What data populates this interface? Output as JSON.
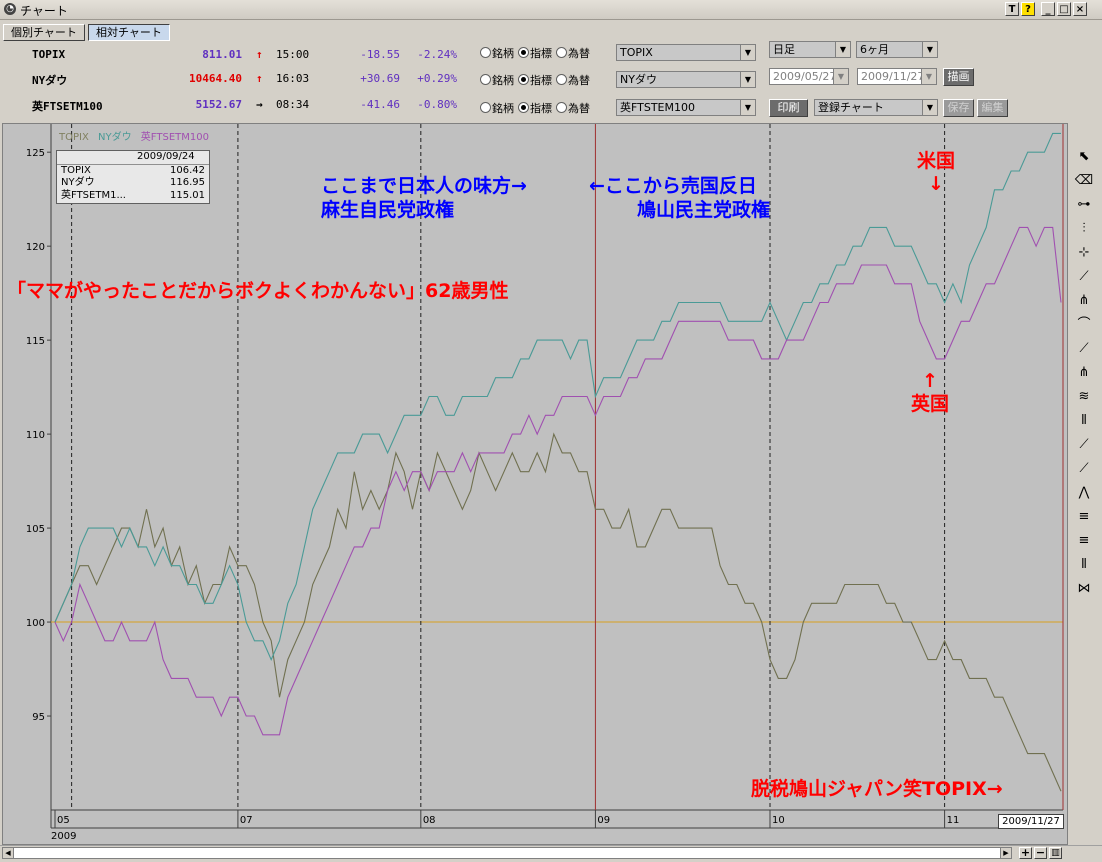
{
  "window": {
    "title": "チャート",
    "buttons": [
      "T",
      "?",
      "_",
      "□",
      "×"
    ]
  },
  "modes": {
    "individual": "個別チャート",
    "relative": "相対チャート"
  },
  "quotes": [
    {
      "name": "TOPIX",
      "price": "811.01",
      "arrow": "↑",
      "time": "15:00",
      "change": "-18.55",
      "pct": "-2.24%",
      "price_color": "#6030c0",
      "arrow_color": "#e00000"
    },
    {
      "name": "NYダウ",
      "price": "10464.40",
      "arrow": "↑",
      "time": "16:03",
      "change": "+30.69",
      "pct": "+0.29%",
      "price_color": "#e00000",
      "arrow_color": "#e00000"
    },
    {
      "name": "英FTSETM100",
      "price": "5152.67",
      "arrow": "→",
      "time": "08:34",
      "change": "-41.46",
      "pct": "-0.80%",
      "price_color": "#6030c0",
      "arrow_color": "#000000"
    }
  ],
  "selectors": [
    {
      "r1": "銘柄",
      "r2": "指標",
      "r3": "為替",
      "value": "TOPIX"
    },
    {
      "r1": "銘柄",
      "r2": "指標",
      "r3": "為替",
      "value": "NYダウ"
    },
    {
      "r1": "銘柄",
      "r2": "指標",
      "r3": "為替",
      "value": "英FTSTEM100"
    }
  ],
  "controls": {
    "period": "日足",
    "span": "6ヶ月",
    "date_from": "2009/05/27",
    "date_to": "2009/11/27",
    "draw": "描画",
    "print": "印刷",
    "saved": "登録チャート",
    "save": "保存",
    "edit": "編集"
  },
  "legend": {
    "topix": "TOPIX",
    "ny": "NYダウ",
    "ftse": "英FTSETM100"
  },
  "infobox": {
    "date": "2009/09/24",
    "rows": [
      {
        "name": "TOPIX",
        "value": "106.42"
      },
      {
        "name": "NYダウ",
        "value": "116.95"
      },
      {
        "name": "英FTSETM1...",
        "value": "115.01"
      }
    ]
  },
  "annotations": {
    "blue_left_1": "ここまで日本人の味方→",
    "blue_left_2": "麻生自民党政権",
    "blue_right_1": "←ここから売国反日",
    "blue_right_2": "鳩山民主党政権",
    "quote": "「ママがやったことだからボクよくわかんない」62歳男性",
    "us": "米国",
    "us_arrow": "↓",
    "uk": "英国",
    "uk_arrow": "↑",
    "bottom": "脱税鳩山ジャパン笑TOPIX→"
  },
  "axis": {
    "year": "2009",
    "end_date": "2009/11/27"
  },
  "colors": {
    "topix": "#707050",
    "ny": "#4a9a96",
    "ftse": "#a050b0",
    "baseline": "#d8a020",
    "annotation_blue": "#0000ff",
    "annotation_red": "#ff0000"
  },
  "tool_icons": [
    "cursor-icon",
    "eraser-icon",
    "hline-icon",
    "vline-icon",
    "cross-icon",
    "trendline-icon",
    "fan-icon",
    "arc-icon",
    "fibonacci-fan-icon",
    "speed-lines-icon",
    "parallel-icon",
    "fib-retracement-icon",
    "channel-icon",
    "gann-fan-icon",
    "zigzag-icon",
    "three-lines-icon",
    "three-lines-b-icon",
    "cycle-icon",
    "wave-icon"
  ],
  "chart_data": {
    "type": "line",
    "ylim": [
      90,
      126.5
    ],
    "y_ticks": [
      95,
      100,
      105,
      110,
      115,
      120,
      125
    ],
    "x_months": [
      {
        "label": "05",
        "index": 0
      },
      {
        "label": "07",
        "index": 22
      },
      {
        "label": "08",
        "index": 44
      },
      {
        "label": "09",
        "index": 65
      },
      {
        "label": "10",
        "index": 86
      },
      {
        "label": "11",
        "index": 107
      }
    ],
    "baseline": 100,
    "vlines_dashed": [
      2,
      22,
      44,
      86,
      107
    ],
    "vline_red_index": 65,
    "series": [
      {
        "name": "TOPIX",
        "values": [
          100,
          101,
          102,
          103,
          103,
          102,
          103,
          104,
          105,
          105,
          104,
          106,
          104,
          105,
          103,
          104,
          102,
          103,
          101,
          102,
          102,
          104,
          103,
          103,
          102,
          100,
          99,
          96,
          98,
          99,
          100,
          102,
          103,
          104,
          106,
          105,
          108,
          106,
          107,
          106,
          107,
          109,
          108,
          106,
          108,
          107,
          109,
          108,
          107,
          106,
          107,
          109,
          108,
          107,
          108,
          109,
          108,
          108,
          109,
          108,
          110,
          109,
          109,
          108,
          108,
          106,
          106,
          105,
          105,
          106,
          104,
          104,
          105,
          106,
          106,
          105,
          105,
          105,
          105,
          105,
          103,
          102,
          102,
          101,
          101,
          100,
          98,
          97,
          97,
          98,
          100,
          101,
          101,
          101,
          101,
          102,
          102,
          102,
          102,
          102,
          101,
          101,
          100,
          100,
          99,
          98,
          98,
          99,
          98,
          98,
          97,
          97,
          97,
          96,
          96,
          95,
          94,
          93,
          93,
          93,
          92,
          91
        ]
      },
      {
        "name": "NYダウ",
        "values": [
          100,
          101,
          102,
          104,
          105,
          105,
          105,
          105,
          104,
          105,
          104,
          104,
          103,
          104,
          103,
          103,
          102,
          102,
          101,
          101,
          102,
          103,
          102,
          100,
          99,
          99,
          98,
          99,
          101,
          102,
          104,
          106,
          107,
          108,
          109,
          109,
          109,
          110,
          110,
          110,
          109,
          110,
          111,
          111,
          111,
          112,
          112,
          111,
          111,
          112,
          112,
          112,
          112,
          113,
          113,
          113,
          114,
          114,
          115,
          115,
          115,
          115,
          114,
          115,
          115,
          112,
          113,
          113,
          113,
          114,
          115,
          115,
          115,
          116,
          116,
          117,
          117,
          117,
          117,
          117,
          117,
          116,
          116,
          116,
          116,
          116,
          117,
          116,
          115,
          116,
          117,
          117,
          118,
          118,
          119,
          119,
          120,
          120,
          121,
          121,
          121,
          120,
          120,
          120,
          119,
          118,
          118,
          117,
          118,
          117,
          119,
          120,
          121,
          123,
          123,
          124,
          124,
          125,
          125,
          125,
          126,
          126
        ]
      },
      {
        "name": "英FTSETM100",
        "values": [
          100,
          99,
          100,
          102,
          101,
          100,
          99,
          99,
          100,
          99,
          99,
          99,
          100,
          98,
          97,
          97,
          97,
          96,
          96,
          96,
          95,
          96,
          96,
          95,
          95,
          94,
          94,
          94,
          96,
          97,
          98,
          99,
          100,
          101,
          102,
          103,
          104,
          104,
          105,
          105,
          107,
          108,
          107,
          108,
          108,
          107,
          108,
          108,
          108,
          109,
          108,
          109,
          109,
          109,
          109,
          110,
          110,
          111,
          110,
          111,
          111,
          112,
          112,
          112,
          112,
          111,
          112,
          112,
          112,
          113,
          113,
          114,
          114,
          114,
          115,
          116,
          116,
          116,
          116,
          116,
          116,
          115,
          115,
          115,
          115,
          114,
          114,
          114,
          115,
          115,
          115,
          116,
          117,
          117,
          118,
          118,
          118,
          119,
          119,
          119,
          119,
          118,
          118,
          118,
          116,
          115,
          114,
          114,
          115,
          116,
          116,
          117,
          118,
          118,
          119,
          120,
          121,
          121,
          120,
          121,
          121,
          117
        ]
      }
    ]
  }
}
